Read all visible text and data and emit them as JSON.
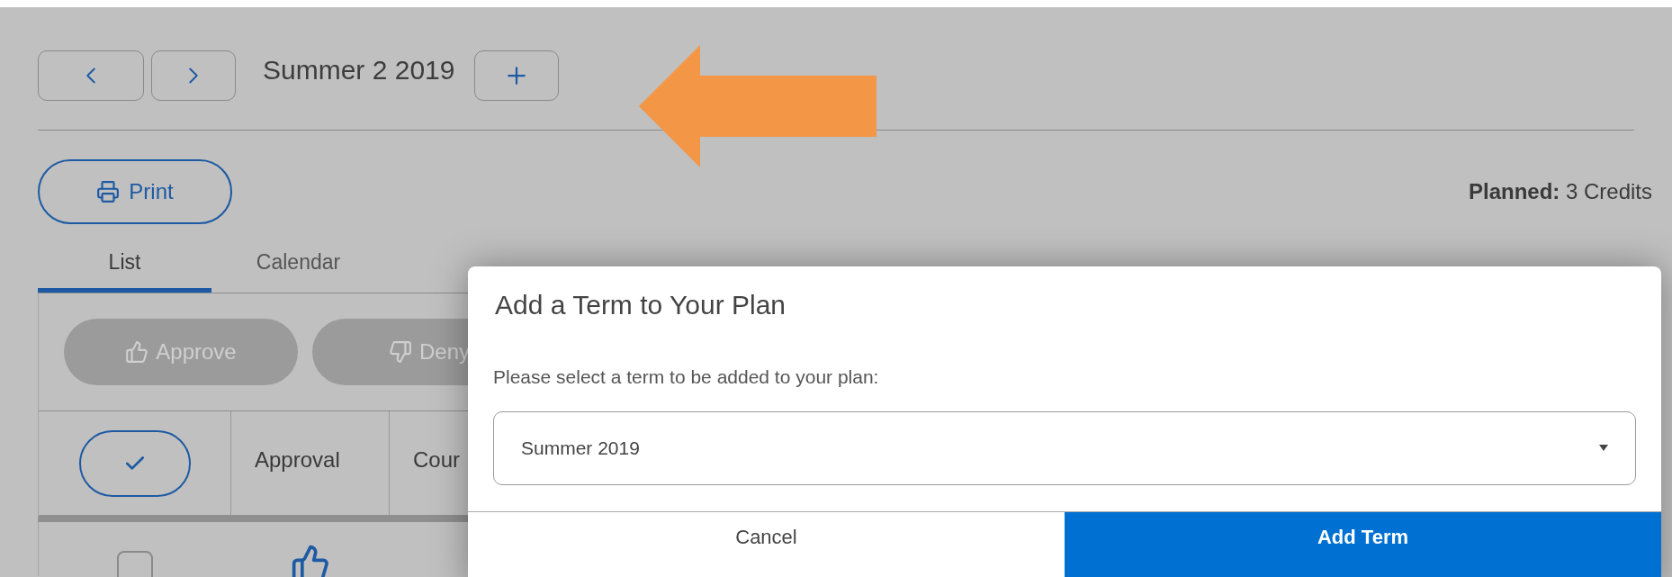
{
  "term_nav": {
    "title": "Summer 2 2019"
  },
  "toolbar": {
    "print": "Print",
    "planned": "**Planned:** 3 Credits"
  },
  "tabs": [
    {
      "label": "List",
      "selected": true
    },
    {
      "label": "Calendar",
      "selected": false
    }
  ],
  "actions": [
    {
      "label": "Approve",
      "disabled": true,
      "kind": "approve"
    },
    {
      "label": "Deny",
      "disabled": true,
      "kind": "deny"
    }
  ],
  "table": {
    "columns": [
      "Approval",
      "Cour"
    ],
    "rows": [
      {
        "checked": false
      }
    ]
  },
  "dialog": {
    "title": "Add a Term to Your Plan",
    "prompt": "Please select a term to be added to your plan:",
    "select": {
      "value": "Summer 2019"
    },
    "buttons": [
      {
        "label": "Cancel",
        "kind": "secondary"
      },
      {
        "label": "Add Term",
        "kind": "primary"
      }
    ]
  }
}
